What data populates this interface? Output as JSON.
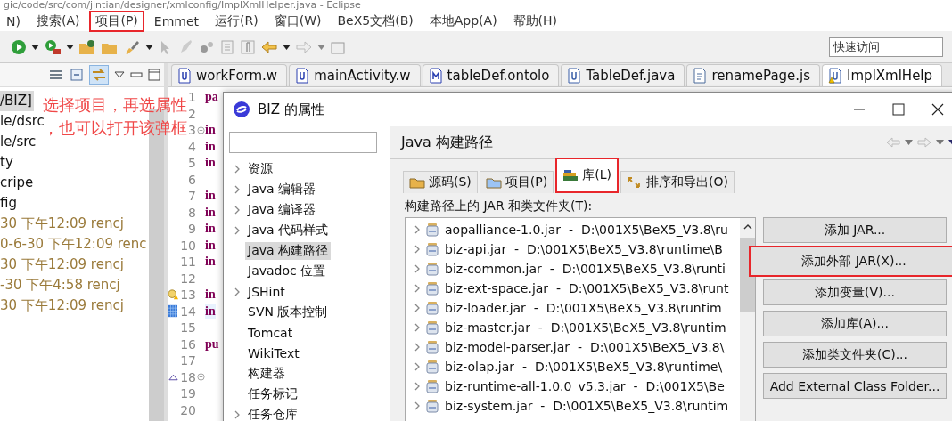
{
  "window": {
    "title": "gic/code/src/com/jintian/designer/xmlconfig/ImplXmlHelper.java - Eclipse"
  },
  "menu": [
    {
      "label": "N)",
      "highlighted": false
    },
    {
      "label": "搜索(A)",
      "highlighted": false
    },
    {
      "label": "项目(P)",
      "highlighted": true
    },
    {
      "label": "Emmet",
      "highlighted": false
    },
    {
      "label": "运行(R)",
      "highlighted": false
    },
    {
      "label": "窗口(W)",
      "highlighted": false
    },
    {
      "label": "BeX5文档(B)",
      "highlighted": false
    },
    {
      "label": "本地App(A)",
      "highlighted": false
    },
    {
      "label": "帮助(H)",
      "highlighted": false
    }
  ],
  "quick_access": {
    "placeholder": "快速访问"
  },
  "explorer": {
    "items": [
      {
        "text": "/BIZ]",
        "kind": "resource",
        "selected": true
      },
      {
        "text": "le/dsrc",
        "kind": "resource",
        "selected": false
      },
      {
        "text": "le/src",
        "kind": "resource",
        "selected": false
      },
      {
        "text": "ty",
        "kind": "resource",
        "selected": false
      },
      {
        "text": "cripe",
        "kind": "resource",
        "selected": false
      },
      {
        "text": "fig",
        "kind": "resource",
        "selected": false
      },
      {
        "text": "30 下午12:09  rencj",
        "kind": "decoration",
        "selected": false
      },
      {
        "text": "0-6-30 下午12:09  renc",
        "kind": "decoration",
        "selected": false
      },
      {
        "text": "30 下午12:09  rencj",
        "kind": "decoration",
        "selected": false
      },
      {
        "text": "-30 下午4:58  rencj",
        "kind": "decoration",
        "selected": false
      },
      {
        "text": "30 下午12:09  rencj",
        "kind": "decoration",
        "selected": false
      }
    ]
  },
  "annotation": {
    "lines": [
      "选择项目，再选属性",
      "，也可以打开该弹框"
    ]
  },
  "editor": {
    "tabs": [
      {
        "label": "workForm.w",
        "kind": "w",
        "selected": false,
        "warning": false
      },
      {
        "label": "mainActivity.w",
        "kind": "w",
        "selected": false,
        "warning": false
      },
      {
        "label": "tableDef.ontolo",
        "kind": "ontology",
        "selected": false,
        "warning": false
      },
      {
        "label": "TableDef.java",
        "kind": "java",
        "selected": false,
        "warning": false
      },
      {
        "label": "renamePage.js",
        "kind": "js",
        "selected": false,
        "warning": false
      },
      {
        "label": "ImplXmlHelp",
        "kind": "java",
        "selected": true,
        "warning": true
      }
    ],
    "lines": [
      {
        "number": "1",
        "code": "pa"
      },
      {
        "number": "2"
      },
      {
        "number": "3",
        "code": "in",
        "foldable": true
      },
      {
        "number": "4",
        "code": "in"
      },
      {
        "number": "5",
        "code": "in"
      },
      {
        "number": "6"
      },
      {
        "number": "7",
        "code": "in"
      },
      {
        "number": "8",
        "code": "in"
      },
      {
        "number": "9",
        "code": "in"
      },
      {
        "number": "10",
        "code": "in"
      },
      {
        "number": "11",
        "code": "in"
      },
      {
        "number": "12"
      },
      {
        "number": "13",
        "code": "in",
        "kind": "warning"
      },
      {
        "number": "14",
        "code": "in",
        "kind": "bookmark",
        "current": true
      },
      {
        "number": "15"
      },
      {
        "number": "16",
        "code": "pu"
      },
      {
        "number": "17"
      },
      {
        "number": "18",
        "kind": "override",
        "foldable": true
      },
      {
        "number": "19"
      },
      {
        "number": "20"
      }
    ]
  },
  "dialog": {
    "title": "BIZ 的属性",
    "nav": [
      {
        "label": "资源",
        "expandable": true,
        "selected": false
      },
      {
        "label": "Java 编辑器",
        "expandable": true,
        "selected": false
      },
      {
        "label": "Java 编译器",
        "expandable": true,
        "selected": false
      },
      {
        "label": "Java 代码样式",
        "expandable": true,
        "selected": false
      },
      {
        "label": "Java 构建路径",
        "expandable": false,
        "selected": true
      },
      {
        "label": "Javadoc 位置",
        "expandable": false,
        "selected": false
      },
      {
        "label": "JSHint",
        "expandable": true,
        "selected": false
      },
      {
        "label": "SVN 版本控制",
        "expandable": false,
        "selected": false
      },
      {
        "label": "Tomcat",
        "expandable": false,
        "selected": false
      },
      {
        "label": "WikiText",
        "expandable": false,
        "selected": false
      },
      {
        "label": "构建器",
        "expandable": false,
        "selected": false
      },
      {
        "label": "任务标记",
        "expandable": false,
        "selected": false
      },
      {
        "label": "任务仓库",
        "expandable": true,
        "selected": false
      }
    ],
    "page_title": "Java 构建路径",
    "tabs": [
      {
        "label": "源码(S)",
        "kind": "source",
        "selected": false,
        "highlighted": false
      },
      {
        "label": "项目(P)",
        "kind": "project",
        "selected": false,
        "highlighted": false
      },
      {
        "label": "库(L)",
        "kind": "library",
        "selected": true,
        "highlighted": true
      },
      {
        "label": "排序和导出(O)",
        "kind": "order",
        "selected": false,
        "highlighted": false
      }
    ],
    "list_label": "构建路径上的 JAR 和类文件夹(T):",
    "jars": [
      {
        "entry": "aopalliance-1.0.jar  -  D:\\001X5\\BeX5_V3.8\\ru"
      },
      {
        "entry": "biz-api.jar  -  D:\\001X5\\BeX5_V3.8\\runtime\\B"
      },
      {
        "entry": "biz-common.jar  -  D:\\001X5\\BeX5_V3.8\\runti"
      },
      {
        "entry": "biz-ext-space.jar  -  D:\\001X5\\BeX5_V3.8\\runt"
      },
      {
        "entry": "biz-loader.jar  -  D:\\001X5\\BeX5_V3.8\\runtim"
      },
      {
        "entry": "biz-master.jar  -  D:\\001X5\\BeX5_V3.8\\runtim"
      },
      {
        "entry": "biz-model-parser.jar  -  D:\\001X5\\BeX5_V3.8\\"
      },
      {
        "entry": "biz-olap.jar  -  D:\\001X5\\BeX5_V3.8\\runtime\\"
      },
      {
        "entry": "biz-runtime-all-1.0.0_v5.3.jar  -  D:\\001X5\\Be"
      },
      {
        "entry": "biz-system.jar  -  D:\\001X5\\BeX5_V3.8\\runtim"
      }
    ],
    "buttons": [
      {
        "label": "添加 JAR...",
        "highlighted": false
      },
      {
        "label": "添加外部 JAR(X)...",
        "highlighted": true
      },
      {
        "label": "添加变量(V)...",
        "highlighted": false
      },
      {
        "label": "添加库(A)...",
        "highlighted": false
      },
      {
        "label": "添加类文件夹(C)...",
        "highlighted": false
      },
      {
        "label": "Add External Class Folder...",
        "highlighted": false
      }
    ]
  }
}
